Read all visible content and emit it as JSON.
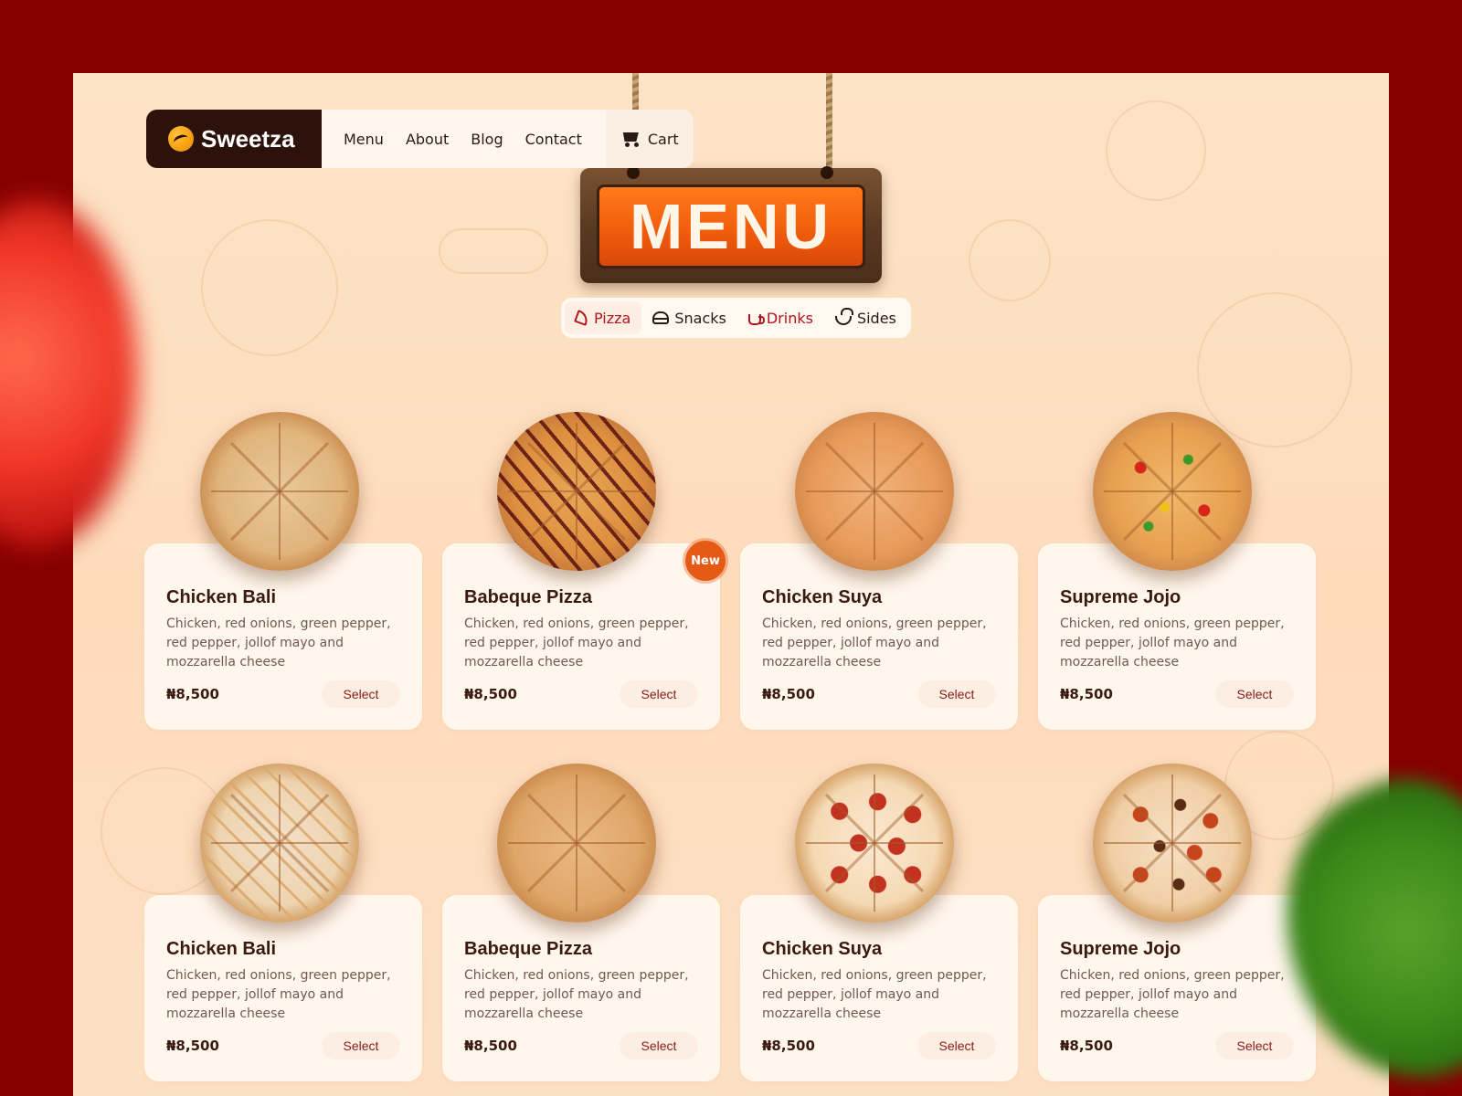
{
  "brand": {
    "name": "Sweetza"
  },
  "nav": {
    "links": [
      "Menu",
      "About",
      "Blog",
      "Contact"
    ],
    "cart_label": "Cart"
  },
  "sign": {
    "text": "MENU"
  },
  "tabs": [
    {
      "label": "Pizza",
      "icon": "pizza-icon",
      "state": "active"
    },
    {
      "label": "Snacks",
      "icon": "burger-icon",
      "state": "normal"
    },
    {
      "label": "Drinks",
      "icon": "cup-icon",
      "state": "accent"
    },
    {
      "label": "Sides",
      "icon": "bowl-icon",
      "state": "normal"
    }
  ],
  "products": [
    {
      "name": "Chicken Bali",
      "desc": "Chicken, red onions, green pepper, red pepper, jollof mayo and mozzarella cheese",
      "price": "₦8,500",
      "button": "Select"
    },
    {
      "name": "Babeque Pizza",
      "desc": "Chicken, red onions, green pepper, red pepper, jollof mayo and mozzarella cheese",
      "price": "₦8,500",
      "button": "Select",
      "badge": "New"
    },
    {
      "name": "Chicken Suya",
      "desc": "Chicken, red onions, green pepper, red pepper, jollof mayo and mozzarella cheese",
      "price": "₦8,500",
      "button": "Select"
    },
    {
      "name": "Supreme Jojo",
      "desc": "Chicken, red onions, green pepper, red pepper, jollof mayo and mozzarella cheese",
      "price": "₦8,500",
      "button": "Select"
    },
    {
      "name": "Chicken Bali",
      "desc": "Chicken, red onions, green pepper, red pepper, jollof mayo and mozzarella cheese",
      "price": "₦8,500",
      "button": "Select"
    },
    {
      "name": "Babeque Pizza",
      "desc": "Chicken, red onions, green pepper, red pepper, jollof mayo and mozzarella cheese",
      "price": "₦8,500",
      "button": "Select"
    },
    {
      "name": "Chicken Suya",
      "desc": "Chicken, red onions, green pepper, red pepper, jollof mayo and mozzarella cheese",
      "price": "₦8,500",
      "button": "Select"
    },
    {
      "name": "Supreme Jojo",
      "desc": "Chicken, red onions, green pepper, red pepper, jollof mayo and mozzarella cheese",
      "price": "₦8,500",
      "button": "Select"
    }
  ],
  "colors": {
    "outer_bg": "#860000",
    "page_bg": "#fde3c6",
    "accent": "#e55a14",
    "brand_dark": "#2d120c",
    "text_red": "#b0141c"
  }
}
